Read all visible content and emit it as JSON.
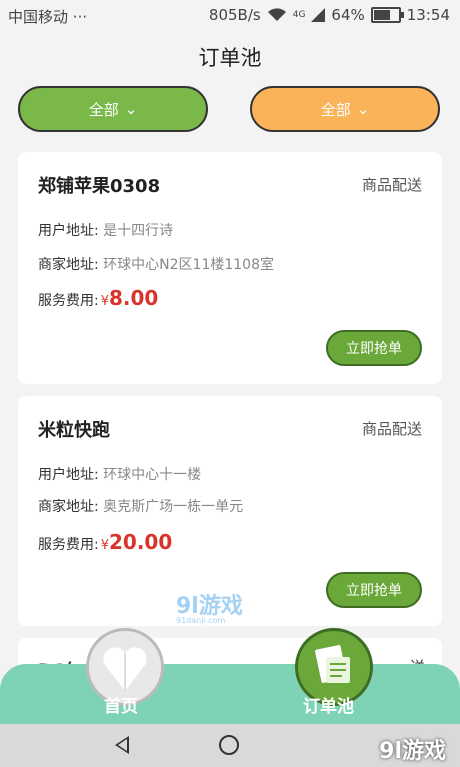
{
  "status_bar": {
    "carrier": "中国移动",
    "dots": "···",
    "speed": "805B/s",
    "network": "4G",
    "battery": "64%",
    "time": "13:54"
  },
  "page_title": "订单池",
  "filters": [
    {
      "label": "全部"
    },
    {
      "label": "全部"
    }
  ],
  "orders": [
    {
      "shop": "郑铺苹果0308",
      "type": "商品配送",
      "user_label": "用户地址:",
      "user_addr": "是十四行诗",
      "merchant_label": "商家地址:",
      "merchant_addr": "环球中心N2区11楼1108室",
      "fee_label": "服务费用:",
      "currency": "¥",
      "fee": "8.00",
      "action": "立即抢单"
    },
    {
      "shop": "米粒快跑",
      "type": "商品配送",
      "user_label": "用户地址:",
      "user_addr": "环球中心十一楼",
      "merchant_label": "商家地址:",
      "merchant_addr": "奥克斯广场一栋一单元",
      "fee_label": "服务费用:",
      "currency": "¥",
      "fee": "20.00",
      "action": "立即抢单"
    }
  ],
  "partial_card": {
    "left_text": "DC仁",
    "right_text": "送"
  },
  "watermark": {
    "text": "9l游戏",
    "sub": "91danji.com"
  },
  "tabs": [
    {
      "label": "首页",
      "icon": "heart-icon"
    },
    {
      "label": "订单池",
      "icon": "order-list-icon"
    }
  ],
  "brand_logo": "9l游戏",
  "colors": {
    "green": "#7bb84a",
    "orange": "#fbb35a",
    "price_red": "#d9342b",
    "tabbar": "#7fd3b5"
  }
}
